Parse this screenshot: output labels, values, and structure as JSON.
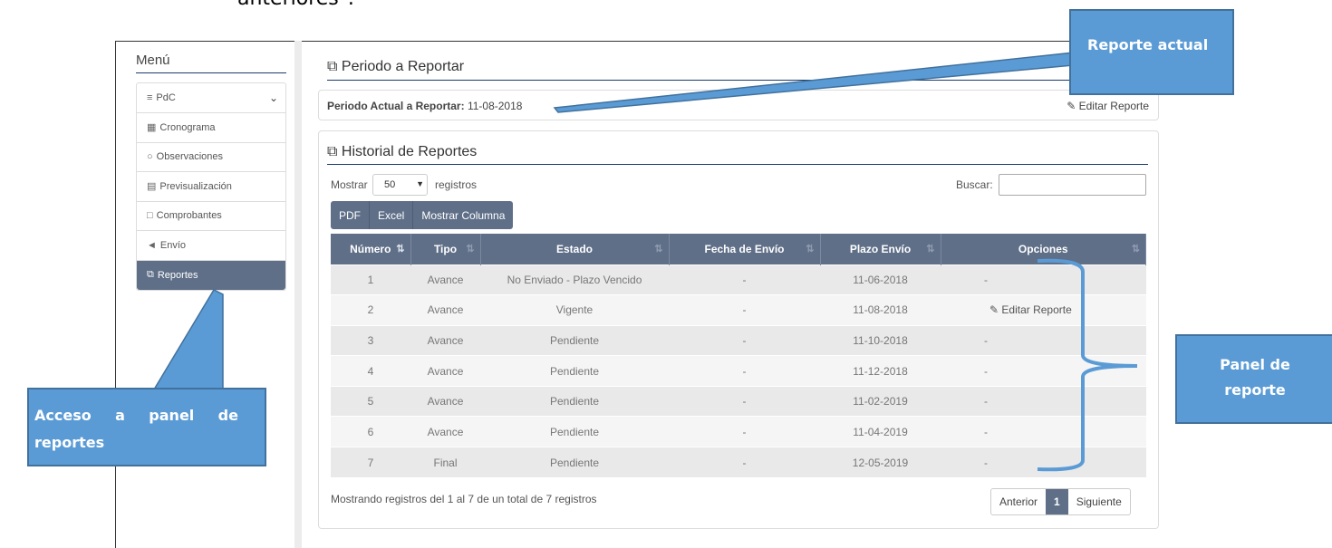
{
  "doc_text": "anteriores\".",
  "sidebar": {
    "title": "Menú",
    "items": [
      {
        "label": "PdC",
        "icon": "list-icon"
      },
      {
        "label": "Cronograma",
        "icon": "calendar-icon"
      },
      {
        "label": "Observaciones",
        "icon": "comment-icon"
      },
      {
        "label": "Previsualización",
        "icon": "preview-icon"
      },
      {
        "label": "Comprobantes",
        "icon": "file-icon"
      },
      {
        "label": "Envío",
        "icon": "send-icon"
      },
      {
        "label": "Reportes",
        "icon": "copy-icon"
      }
    ]
  },
  "periodo": {
    "title": "Periodo a Reportar",
    "label": "Periodo Actual a Reportar:",
    "value": "11-08-2018",
    "edit_label": "Editar Reporte"
  },
  "historial": {
    "title": "Historial de Reportes",
    "show_label": "Mostrar",
    "show_value": "50",
    "records_label": "registros",
    "search_label": "Buscar:",
    "search_value": "",
    "buttons": [
      "PDF",
      "Excel",
      "Mostrar Columna"
    ],
    "columns": [
      "Número",
      "Tipo",
      "Estado",
      "Fecha de Envío",
      "Plazo Envío",
      "Opciones"
    ],
    "rows": [
      [
        "1",
        "Avance",
        "No Enviado - Plazo Vencido",
        "-",
        "11-06-2018",
        "-"
      ],
      [
        "2",
        "Avance",
        "Vigente",
        "-",
        "11-08-2018",
        "Editar Reporte"
      ],
      [
        "3",
        "Avance",
        "Pendiente",
        "-",
        "11-10-2018",
        "-"
      ],
      [
        "4",
        "Avance",
        "Pendiente",
        "-",
        "11-12-2018",
        "-"
      ],
      [
        "5",
        "Avance",
        "Pendiente",
        "-",
        "11-02-2019",
        "-"
      ],
      [
        "6",
        "Avance",
        "Pendiente",
        "-",
        "11-04-2019",
        "-"
      ],
      [
        "7",
        "Final",
        "Pendiente",
        "-",
        "12-05-2019",
        "-"
      ]
    ],
    "info": "Mostrando registros del 1 al 7 de un total de 7 registros",
    "pager": {
      "prev": "Anterior",
      "current": "1",
      "next": "Siguiente"
    }
  },
  "annotations": {
    "top": "Reporte actual",
    "left_line1_a": "Acceso",
    "left_line1_b": "a",
    "left_line1_c": "panel",
    "left_line1_d": "de",
    "left_line2": "reportes",
    "right_line1": "Panel de",
    "right_line2": "reporte"
  },
  "colors": {
    "header": "#5f6f88",
    "callout": "#5b9bd5",
    "title_line": "#1a3b6b"
  }
}
